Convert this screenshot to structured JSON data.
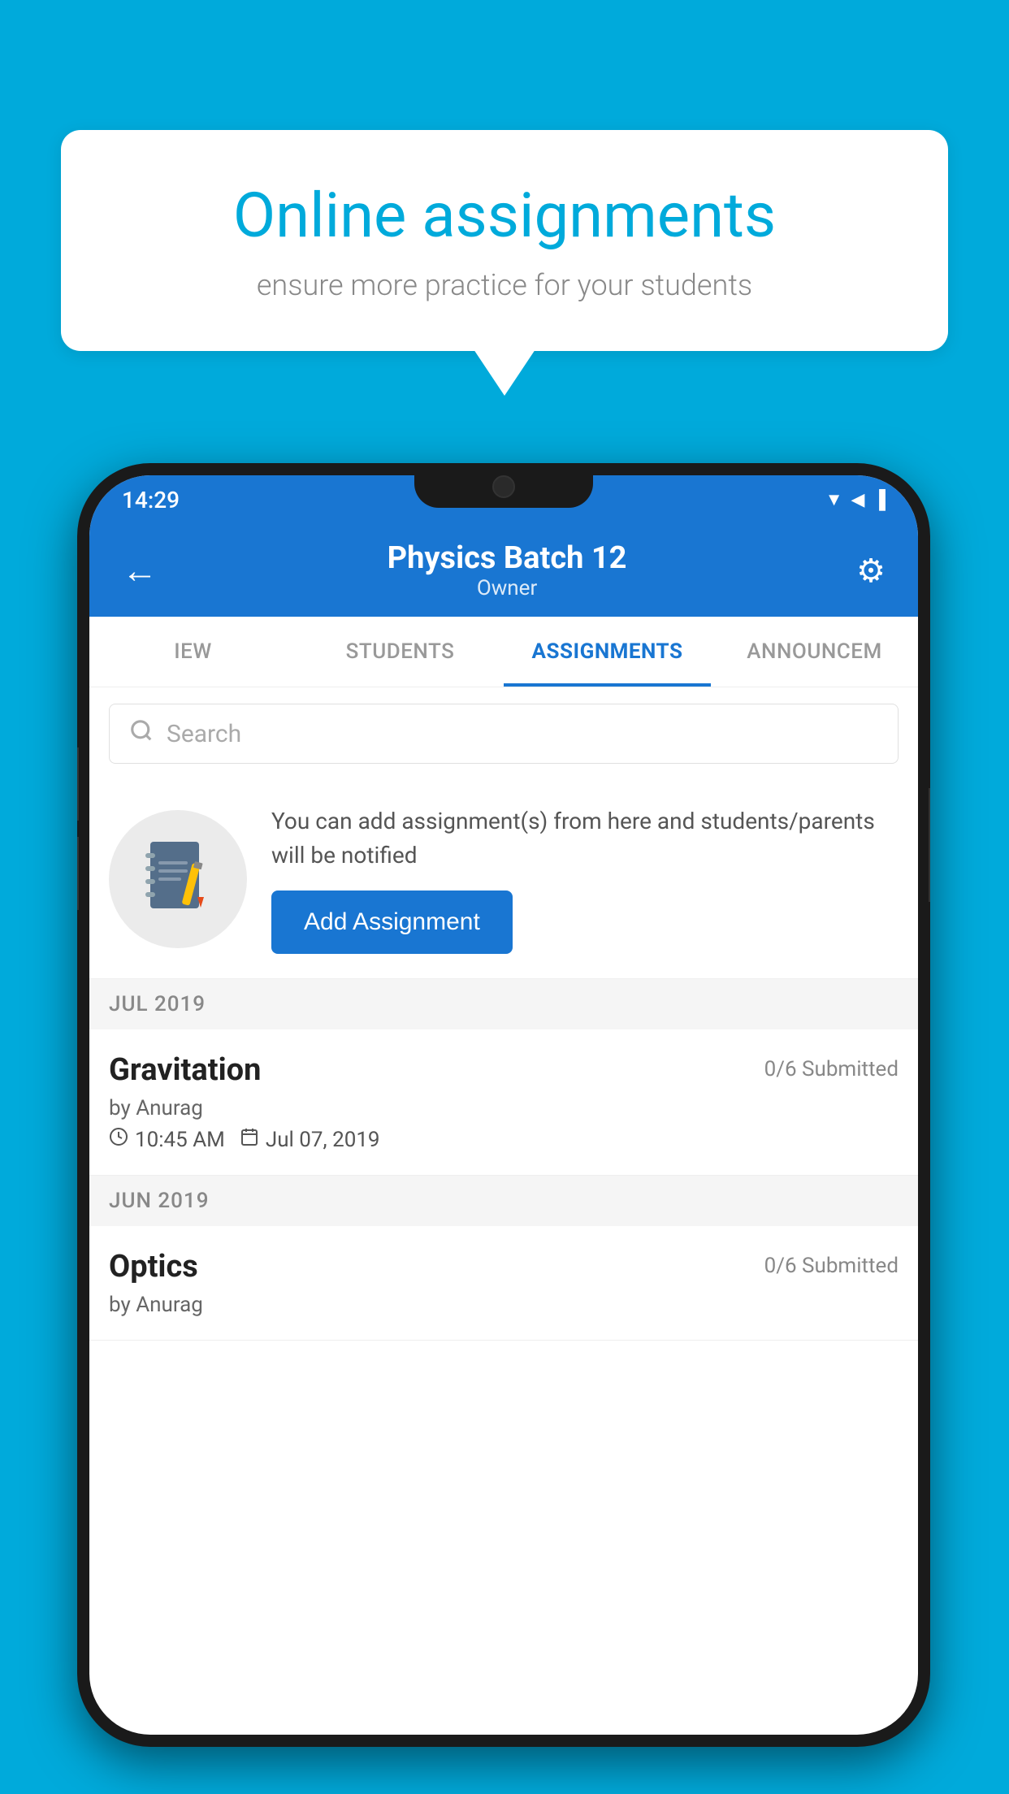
{
  "background_color": "#00AADB",
  "speech_bubble": {
    "title": "Online assignments",
    "subtitle": "ensure more practice for your students"
  },
  "phone": {
    "status_bar": {
      "time": "14:29",
      "icons": "▼◀▐"
    },
    "header": {
      "title": "Physics Batch 12",
      "subtitle": "Owner",
      "back_label": "←",
      "settings_label": "⚙"
    },
    "tabs": [
      {
        "label": "IEW",
        "active": false
      },
      {
        "label": "STUDENTS",
        "active": false
      },
      {
        "label": "ASSIGNMENTS",
        "active": true
      },
      {
        "label": "ANNOUNCEM",
        "active": false
      }
    ],
    "search": {
      "placeholder": "Search"
    },
    "promo": {
      "description": "You can add assignment(s) from here and students/parents will be notified",
      "button_label": "Add Assignment"
    },
    "sections": [
      {
        "month_label": "JUL 2019",
        "assignments": [
          {
            "name": "Gravitation",
            "submitted": "0/6 Submitted",
            "author": "by Anurag",
            "time": "10:45 AM",
            "date": "Jul 07, 2019"
          }
        ]
      },
      {
        "month_label": "JUN 2019",
        "assignments": [
          {
            "name": "Optics",
            "submitted": "0/6 Submitted",
            "author": "by Anurag",
            "time": "",
            "date": ""
          }
        ]
      }
    ]
  }
}
